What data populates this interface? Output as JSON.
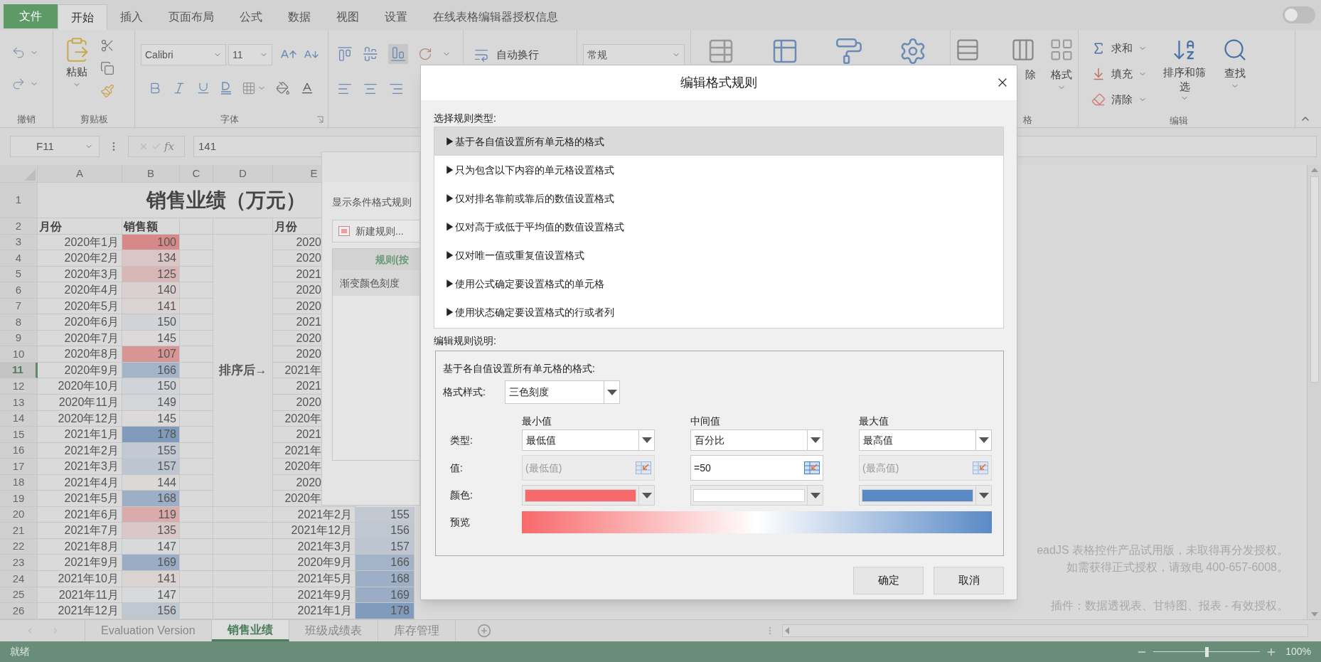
{
  "tabs": [
    {
      "label": "文件",
      "kind": "file",
      "selected": false
    },
    {
      "label": "开始",
      "kind": "tab",
      "selected": true
    },
    {
      "label": "插入",
      "kind": "tab",
      "selected": false
    },
    {
      "label": "页面布局",
      "kind": "tab",
      "selected": false
    },
    {
      "label": "公式",
      "kind": "tab",
      "selected": false
    },
    {
      "label": "数据",
      "kind": "tab",
      "selected": false
    },
    {
      "label": "视图",
      "kind": "tab",
      "selected": false
    },
    {
      "label": "设置",
      "kind": "tab",
      "selected": false
    },
    {
      "label": "在线表格编辑器授权信息",
      "kind": "tab",
      "selected": false
    }
  ],
  "theme_toggle": {
    "on": false
  },
  "ribbon": {
    "undo_label": "撤销",
    "clipboard_label": "剪贴板",
    "paste": "粘贴",
    "font_label": "字体",
    "font_family": "Calibri",
    "font_size": "11",
    "wrap_text": "自动换行",
    "number_format": "常规",
    "delete_partial": "除",
    "format": "格式",
    "cells_label_partial": "格",
    "sum": "求和",
    "fill": "填充",
    "clear": "清除",
    "sort": "排序和筛选",
    "find": "查找",
    "editing_label": "编辑"
  },
  "formula_bar": {
    "cell": "F11",
    "fx": "fx",
    "formula": "141"
  },
  "sheet": {
    "columns": [
      "A",
      "B",
      "C",
      "D",
      "E"
    ],
    "row_headers": [
      {
        "label": "1",
        "selected": false
      },
      {
        "label": "2",
        "selected": false
      },
      {
        "label": "3",
        "selected": false
      },
      {
        "label": "4",
        "selected": false
      },
      {
        "label": "5",
        "selected": false
      },
      {
        "label": "6",
        "selected": false
      },
      {
        "label": "7",
        "selected": false
      },
      {
        "label": "8",
        "selected": false
      },
      {
        "label": "9",
        "selected": false
      },
      {
        "label": "10",
        "selected": false
      },
      {
        "label": "11",
        "selected": true
      },
      {
        "label": "12",
        "selected": false
      },
      {
        "label": "13",
        "selected": false
      },
      {
        "label": "14",
        "selected": false
      },
      {
        "label": "15",
        "selected": false
      },
      {
        "label": "16",
        "selected": false
      },
      {
        "label": "17",
        "selected": false
      },
      {
        "label": "18",
        "selected": false
      },
      {
        "label": "19",
        "selected": false
      },
      {
        "label": "20",
        "selected": false
      },
      {
        "label": "21",
        "selected": false
      },
      {
        "label": "22",
        "selected": false
      },
      {
        "label": "23",
        "selected": false
      },
      {
        "label": "24",
        "selected": false
      },
      {
        "label": "25",
        "selected": false
      },
      {
        "label": "26",
        "selected": false
      }
    ],
    "title": "销售业绩（万元）",
    "header": {
      "month": "月份",
      "sales": "销售额",
      "sorted_month": "月份"
    },
    "side_label": "排序后→",
    "rows": [
      {
        "month": "2020年1月",
        "sales": "100",
        "sorted_month": "2020"
      },
      {
        "month": "2020年2月",
        "sales": "134",
        "sorted_month": "2020"
      },
      {
        "month": "2020年3月",
        "sales": "125",
        "sorted_month": "2021"
      },
      {
        "month": "2020年4月",
        "sales": "140",
        "sorted_month": "2020"
      },
      {
        "month": "2020年5月",
        "sales": "141",
        "sorted_month": "2020"
      },
      {
        "month": "2020年6月",
        "sales": "150",
        "sorted_month": "2021"
      },
      {
        "month": "2020年7月",
        "sales": "145",
        "sorted_month": "2020"
      },
      {
        "month": "2020年8月",
        "sales": "107",
        "sorted_month": "2020"
      },
      {
        "month": "2020年9月",
        "sales": "166",
        "sorted_month": "2021年"
      },
      {
        "month": "2020年10月",
        "sales": "150",
        "sorted_month": "2021"
      },
      {
        "month": "2020年11月",
        "sales": "149",
        "sorted_month": "2020"
      },
      {
        "month": "2020年12月",
        "sales": "145",
        "sorted_month": "2020年"
      },
      {
        "month": "2021年1月",
        "sales": "178",
        "sorted_month": "2021"
      },
      {
        "month": "2021年2月",
        "sales": "155",
        "sorted_month": "2021年"
      },
      {
        "month": "2021年3月",
        "sales": "157",
        "sorted_month": "2020年"
      },
      {
        "month": "2021年4月",
        "sales": "144",
        "sorted_month": "2020"
      },
      {
        "month": "2021年5月",
        "sales": "168",
        "sorted_month": "2020年"
      },
      {
        "month": "2021年6月",
        "sales": "119",
        "sorted_month": "2021年2月",
        "sorted_sales": "155"
      },
      {
        "month": "2021年7月",
        "sales": "135",
        "sorted_month": "2021年12月",
        "sorted_sales": "156"
      },
      {
        "month": "2021年8月",
        "sales": "147",
        "sorted_month": "2021年3月",
        "sorted_sales": "157"
      },
      {
        "month": "2021年9月",
        "sales": "169",
        "sorted_month": "2020年9月",
        "sorted_sales": "166"
      },
      {
        "month": "2021年10月",
        "sales": "141",
        "sorted_month": "2021年5月",
        "sorted_sales": "168"
      },
      {
        "month": "2021年11月",
        "sales": "147",
        "sorted_month": "2021年9月",
        "sorted_sales": "169"
      },
      {
        "month": "2021年12月",
        "sales": "156",
        "sorted_month": "2021年1月",
        "sorted_sales": "178"
      }
    ]
  },
  "notice": [
    "eadJS 表格控件产品试用版，未取得再分发授权。",
    "如需获得正式授权，请致电 400-657-6008。",
    "插件：数据透视表、甘特图、报表 - 有效授权。"
  ],
  "sheet_tabs": [
    {
      "label": "Evaluation Version",
      "selected": false
    },
    {
      "label": "销售业绩",
      "selected": true
    },
    {
      "label": "班级成绩表",
      "selected": false
    },
    {
      "label": "库存管理",
      "selected": false
    }
  ],
  "status_bar": {
    "text": "就绪",
    "zoom": "100%",
    "level": 0.5
  },
  "manager_dialog": {
    "show_label": "显示条件格式规则",
    "new_rule": "新建规则...",
    "column": "规则(按",
    "rule": "渐变颜色刻度"
  },
  "dialog": {
    "title": "编辑格式规则",
    "rule_type_label": "选择规则类型:",
    "rule_types": [
      {
        "label": "▶基于各自值设置所有单元格的格式",
        "selected": true
      },
      {
        "label": "▶只为包含以下内容的单元格设置格式",
        "selected": false
      },
      {
        "label": "▶仅对排名靠前或靠后的数值设置格式",
        "selected": false
      },
      {
        "label": "▶仅对高于或低于平均值的数值设置格式",
        "selected": false
      },
      {
        "label": "▶仅对唯一值或重复值设置格式",
        "selected": false
      },
      {
        "label": "▶使用公式确定要设置格式的单元格",
        "selected": false
      },
      {
        "label": "▶使用状态确定要设置格式的行或者列",
        "selected": false
      }
    ],
    "description_label": "编辑规则说明:",
    "description": "基于各自值设置所有单元格的格式:",
    "style_label": "格式样式:",
    "style": "三色刻度",
    "row_labels": {
      "type": "类型:",
      "value": "值:",
      "color_row": "颜色:",
      "preview": "预览"
    },
    "points": [
      {
        "heading": "最小值",
        "type": "最低值",
        "placeholder": "(最低值)",
        "disabled": true,
        "color": "#f8696b"
      },
      {
        "heading": "中间值",
        "type": "百分比",
        "value": "=50",
        "disabled": false,
        "color": "#ffffff"
      },
      {
        "heading": "最大值",
        "type": "最高值",
        "placeholder": "(最高值)",
        "disabled": true,
        "color": "#5a8ac6"
      }
    ],
    "buttons": [
      "确定",
      "取消"
    ]
  }
}
